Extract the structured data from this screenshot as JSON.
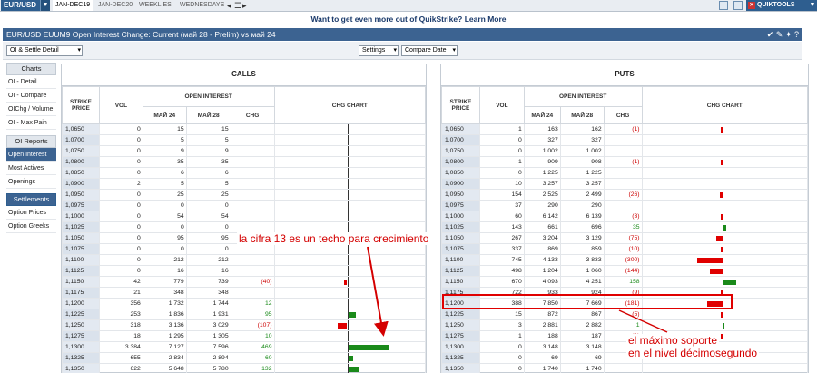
{
  "topbar": {
    "symbol": "EUR/USD",
    "tabs": [
      "JAN-DEC19",
      "JAN-DEC20",
      "WEEKLIES",
      "WEDNESDAYS"
    ],
    "quiktools": "QUIKTOOLS"
  },
  "promo": {
    "text": "Want to get even more out of QuikStrike?",
    "link": "Learn More"
  },
  "title": "EUR/USD EUUM9 Open Interest Change: Current (май 28 - Prelim) vs май 24",
  "toolbar": {
    "view": "OI & Settle Detail",
    "settings": "Settings",
    "compare": "Compare Date"
  },
  "sidebar": {
    "charts_header": "Charts",
    "charts": [
      "OI - Detail",
      "OI - Compare",
      "OIChg / Volume",
      "OI - Max Pain"
    ],
    "reports_header": "OI Reports",
    "reports": [
      "Open Interest",
      "Most Actives",
      "Openings"
    ],
    "settlements_header": "Settlements",
    "settlements": [
      "Option Prices",
      "Option Greeks"
    ]
  },
  "calls": {
    "title": "CALLS",
    "headers": {
      "strike": "STRIKE PRICE",
      "vol": "VOL",
      "oi": "OPEN INTEREST",
      "may24": "МАЙ 24",
      "may28": "МАЙ 28",
      "chg": "CHG",
      "chart": "CHG CHART"
    },
    "rows": [
      [
        "1,0650",
        "0",
        "15",
        "15",
        ""
      ],
      [
        "1,0700",
        "0",
        "5",
        "5",
        ""
      ],
      [
        "1,0750",
        "0",
        "9",
        "9",
        ""
      ],
      [
        "1,0800",
        "0",
        "35",
        "35",
        ""
      ],
      [
        "1,0850",
        "0",
        "6",
        "6",
        ""
      ],
      [
        "1,0900",
        "2",
        "5",
        "5",
        ""
      ],
      [
        "1,0950",
        "0",
        "25",
        "25",
        ""
      ],
      [
        "1,0975",
        "0",
        "0",
        "0",
        ""
      ],
      [
        "1,1000",
        "0",
        "54",
        "54",
        ""
      ],
      [
        "1,1025",
        "0",
        "0",
        "0",
        ""
      ],
      [
        "1,1050",
        "0",
        "95",
        "95",
        ""
      ],
      [
        "1,1075",
        "0",
        "0",
        "0",
        ""
      ],
      [
        "1,1100",
        "0",
        "212",
        "212",
        ""
      ],
      [
        "1,1125",
        "0",
        "16",
        "16",
        ""
      ],
      [
        "1,1150",
        "42",
        "779",
        "739",
        "(40)"
      ],
      [
        "1,1175",
        "21",
        "348",
        "348",
        ""
      ],
      [
        "1,1200",
        "356",
        "1 732",
        "1 744",
        "12"
      ],
      [
        "1,1225",
        "253",
        "1 836",
        "1 931",
        "95"
      ],
      [
        "1,1250",
        "318",
        "3 136",
        "3 029",
        "(107)"
      ],
      [
        "1,1275",
        "18",
        "1 295",
        "1 305",
        "10"
      ],
      [
        "1,1300",
        "3 384",
        "7 127",
        "7 596",
        "469"
      ],
      [
        "1,1325",
        "655",
        "2 834",
        "2 894",
        "60"
      ],
      [
        "1,1350",
        "622",
        "5 648",
        "5 780",
        "132"
      ]
    ]
  },
  "puts": {
    "title": "PUTS",
    "headers": {
      "strike": "STRIKE PRICE",
      "vol": "VOL",
      "oi": "OPEN INTEREST",
      "may24": "МАЙ 24",
      "may28": "МАЙ 28",
      "chg": "CHG",
      "chart": "CHG CHART"
    },
    "rows": [
      [
        "1,0650",
        "1",
        "163",
        "162",
        "(1)"
      ],
      [
        "1,0700",
        "0",
        "327",
        "327",
        ""
      ],
      [
        "1,0750",
        "0",
        "1 002",
        "1 002",
        ""
      ],
      [
        "1,0800",
        "1",
        "909",
        "908",
        "(1)"
      ],
      [
        "1,0850",
        "0",
        "1 225",
        "1 225",
        ""
      ],
      [
        "1,0900",
        "10",
        "3 257",
        "3 257",
        ""
      ],
      [
        "1,0950",
        "154",
        "2 525",
        "2 499",
        "(26)"
      ],
      [
        "1,0975",
        "37",
        "290",
        "290",
        ""
      ],
      [
        "1,1000",
        "60",
        "6 142",
        "6 139",
        "(3)"
      ],
      [
        "1,1025",
        "143",
        "661",
        "696",
        "35"
      ],
      [
        "1,1050",
        "267",
        "3 204",
        "3 129",
        "(75)"
      ],
      [
        "1,1075",
        "337",
        "869",
        "859",
        "(10)"
      ],
      [
        "1,1100",
        "745",
        "4 133",
        "3 833",
        "(300)"
      ],
      [
        "1,1125",
        "498",
        "1 204",
        "1 060",
        "(144)"
      ],
      [
        "1,1150",
        "670",
        "4 093",
        "4 251",
        "158"
      ],
      [
        "1,1175",
        "722",
        "933",
        "924",
        "(9)"
      ],
      [
        "1,1200",
        "388",
        "7 850",
        "7 669",
        "(181)"
      ],
      [
        "1,1225",
        "15",
        "872",
        "867",
        "(5)"
      ],
      [
        "1,1250",
        "3",
        "2 881",
        "2 882",
        "1"
      ],
      [
        "1,1275",
        "1",
        "188",
        "187",
        "(1)"
      ],
      [
        "1,1300",
        "0",
        "3 148",
        "3 148",
        ""
      ],
      [
        "1,1325",
        "0",
        "69",
        "69",
        ""
      ],
      [
        "1,1350",
        "0",
        "1 740",
        "1 740",
        ""
      ]
    ]
  },
  "annotations": {
    "ceiling": "la cifra 13 es un techo para crecimiento",
    "support_1": "el máximo soporte",
    "support_2": "en el nivel décimosegundo"
  },
  "colors": {
    "positive": "#1a8a1a",
    "negative": "#e00000",
    "header": "#3c6391"
  }
}
